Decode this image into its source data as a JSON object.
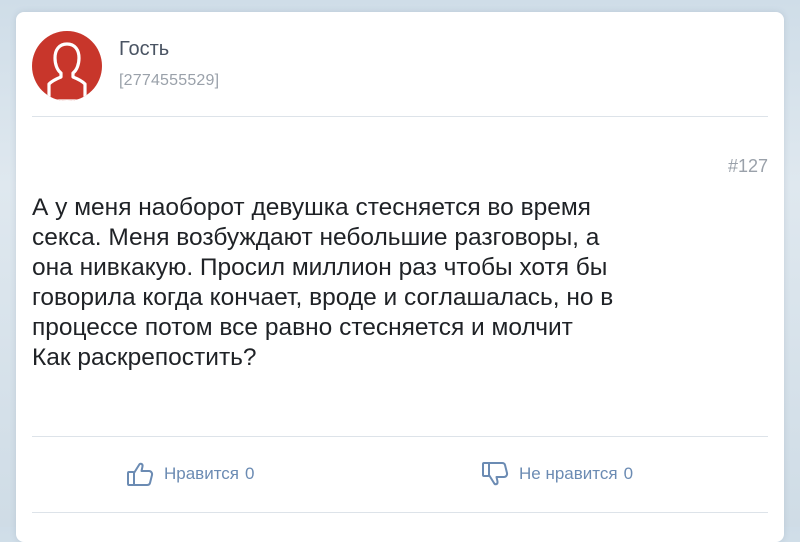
{
  "author": {
    "name": "Гость",
    "id": "[2774555529]"
  },
  "post": {
    "number": "#127",
    "lines": [
      "А у меня наоборот девушка стесняется во время",
      "секса. Меня возбуждают небольшие разговоры, а",
      "она нивкакую. Просил миллион раз чтобы хотя бы",
      "говорила когда кончает, вроде и соглашалась, но в",
      "процессе потом все равно стесняется и молчит",
      "Как раскрепостить?"
    ]
  },
  "reactions": {
    "like_label": "Нравится",
    "like_count": "0",
    "dislike_label": "Не нравится",
    "dislike_count": "0"
  },
  "icons": {
    "avatar": "user-silhouette-icon",
    "like": "thumbs-up-icon",
    "dislike": "thumbs-down-icon"
  },
  "colors": {
    "avatar_bg": "#c8362b",
    "accent": "#6b8bb3",
    "text": "#1f2226",
    "muted": "#9aa1aa"
  }
}
